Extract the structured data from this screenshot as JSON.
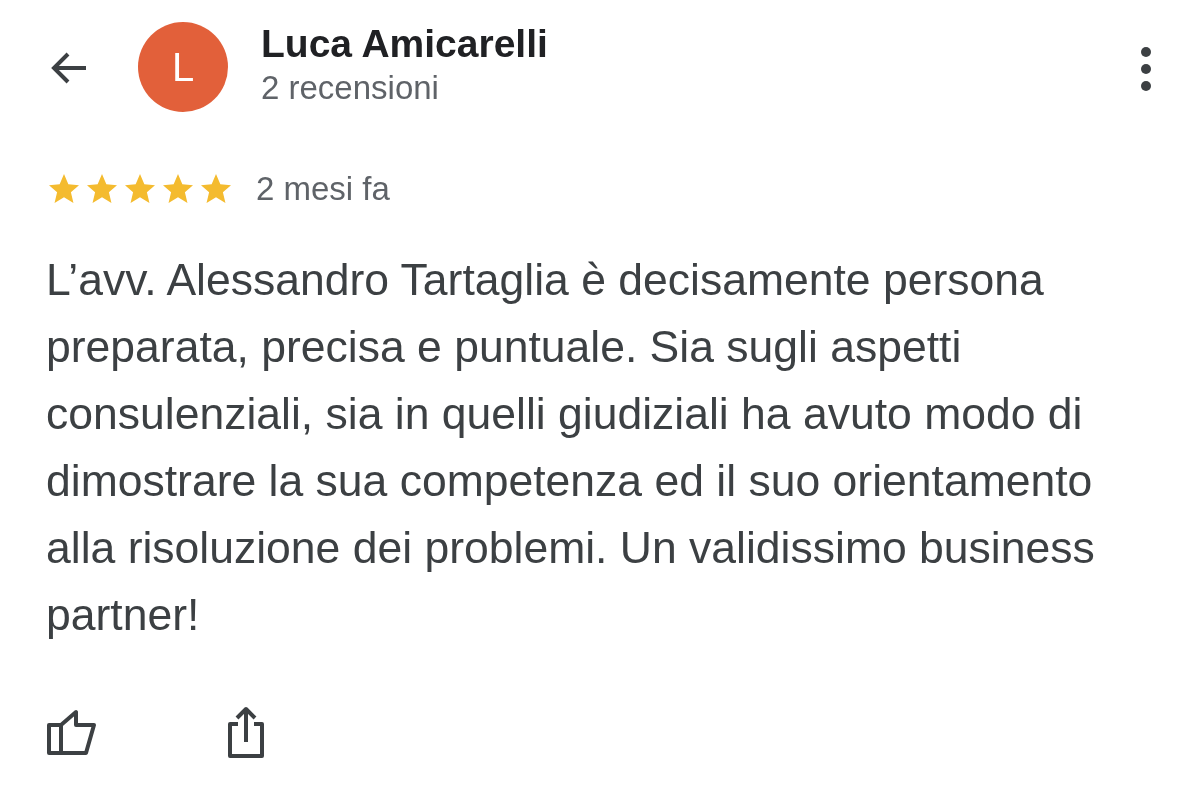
{
  "reviewer": {
    "avatar_letter": "L",
    "name": "Luca Amicarelli",
    "subtitle": "2 recensioni"
  },
  "review": {
    "stars": 5,
    "time": "2 mesi fa",
    "text": "L’avv. Alessandro Tartaglia è decisamente persona preparata, precisa e puntuale. Sia sugli aspetti consulenziali, sia in quelli giudiziali ha avuto modo di dimostrare la sua competenza ed il suo orientamento alla risoluzione dei problemi. Un validissimo business partner!"
  }
}
